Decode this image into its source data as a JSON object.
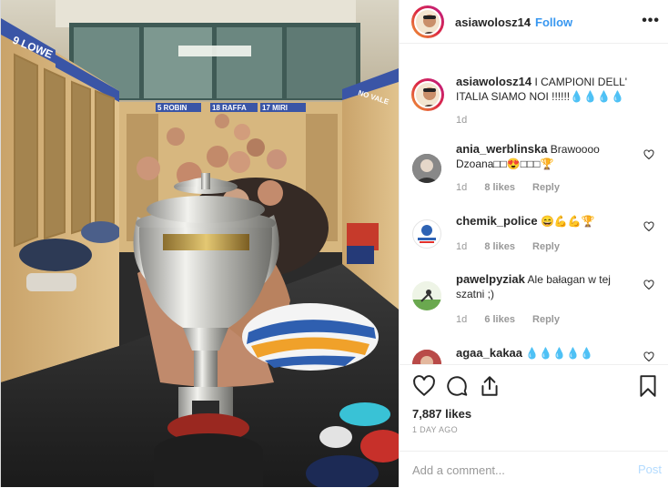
{
  "post": {
    "username": "asiawolosz14",
    "follow_label": "Follow",
    "separator": "•",
    "more_label": "•••",
    "caption": {
      "username": "asiawolosz14",
      "text": "I CAMPIONI DELL' ITALIA SIAMO NOI !!!!!!💧💧💧💧",
      "time": "1d"
    },
    "photo": {
      "locker_labels": [
        "9  LOWE",
        "5  ROBIN",
        "18  RAFFA",
        "17  MIRI",
        "NO  VALE"
      ]
    }
  },
  "comments": [
    {
      "username": "ania_werblinska",
      "text": "Brawoooo Dzoana□□😍□□□🏆",
      "time": "1d",
      "likes": "8 likes",
      "reply": "Reply"
    },
    {
      "username": "chemik_police",
      "text": "😄💪💪🏆",
      "time": "1d",
      "likes": "8 likes",
      "reply": "Reply"
    },
    {
      "username": "pawelpyziak",
      "text": "Ale bałagan w tej szatni ;)",
      "time": "1d",
      "likes": "6 likes",
      "reply": "Reply"
    },
    {
      "username": "agaa_kakaa",
      "text": "💧💧💧💧💧",
      "time": "",
      "likes": "",
      "reply": ""
    }
  ],
  "actions": {
    "like_icon": "heart-icon",
    "comment_icon": "comment-icon",
    "share_icon": "share-icon",
    "save_icon": "bookmark-icon"
  },
  "likes_count": "7,887 likes",
  "time_ago": "1 DAY AGO",
  "add_comment": {
    "placeholder": "Add a comment...",
    "post_label": "Post"
  },
  "colors": {
    "link": "#3897f0",
    "post_disabled": "#b3dbff",
    "meta": "#999999"
  }
}
